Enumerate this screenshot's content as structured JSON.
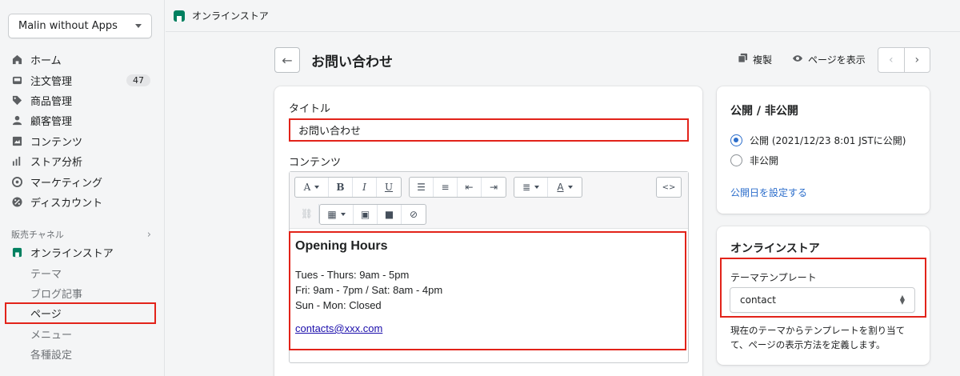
{
  "sidebar": {
    "store_name": "Malin without Apps",
    "nav": [
      {
        "label": "ホーム",
        "icon": "home-icon"
      },
      {
        "label": "注文管理",
        "icon": "inbox-icon",
        "badge": "47"
      },
      {
        "label": "商品管理",
        "icon": "tag-icon"
      },
      {
        "label": "顧客管理",
        "icon": "person-icon"
      },
      {
        "label": "コンテンツ",
        "icon": "image-icon"
      },
      {
        "label": "ストア分析",
        "icon": "bar-chart-icon"
      },
      {
        "label": "マーケティング",
        "icon": "target-icon"
      },
      {
        "label": "ディスカウント",
        "icon": "discount-icon"
      }
    ],
    "channels_label": "販売チャネル",
    "channel": {
      "label": "オンラインストア",
      "icon": "store-icon"
    },
    "sub_items": [
      "テーマ",
      "ブログ記事",
      "ページ",
      "メニュー",
      "各種設定"
    ]
  },
  "topbar": {
    "title": "オンラインストア"
  },
  "header": {
    "title": "お問い合わせ",
    "duplicate_label": "複製",
    "view_label": "ページを表示"
  },
  "main": {
    "title_label": "タイトル",
    "title_value": "お問い合わせ",
    "content_label": "コンテンツ",
    "toolbar": {
      "code_label": "<>"
    },
    "content": {
      "heading": "Opening Hours",
      "lines": [
        "Tues - Thurs: 9am - 5pm",
        "Fri: 9am - 7pm / Sat: 8am - 4pm",
        "Sun - Mon: Closed"
      ],
      "email": "contacts@xxx.com"
    }
  },
  "visibility": {
    "title": "公開 / 非公開",
    "published_label": "公開 (2021/12/23 8:01 JSTに公開)",
    "hidden_label": "非公開",
    "set_date_link": "公開日を設定する"
  },
  "online_store": {
    "title": "オンラインストア",
    "template_label": "テーマテンプレート",
    "template_value": "contact",
    "help": "現在のテーマからテンプレートを割り当てて、ページの表示方法を定義します。"
  },
  "colors": {
    "highlight": "#e2231a",
    "link": "#2c6ecb",
    "brand": "#008060"
  }
}
